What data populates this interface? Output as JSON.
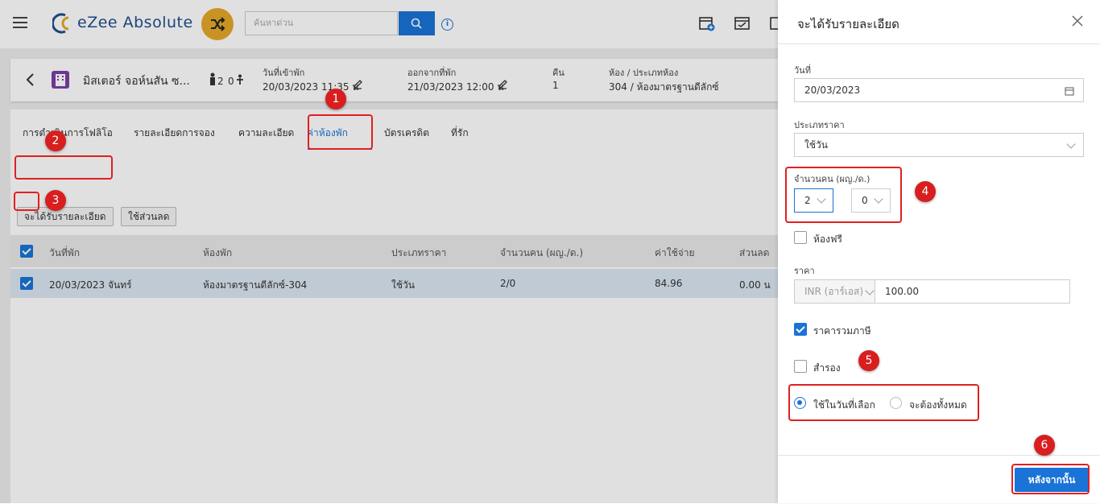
{
  "app": {
    "name": "eZee Absolute",
    "search_placeholder": "ค้นหาด่วน"
  },
  "guest": {
    "name": "มิสเตอร์ จอห์นสัน ซ...",
    "adults": "2",
    "children": "0",
    "checkin_label": "วันที่เข้าพัก",
    "checkin_value": "20/03/2023 11:35 น",
    "checkout_label": "ออกจากที่พัก",
    "checkout_value": "21/03/2023 12:00 น",
    "nights_label": "คืน",
    "nights_value": "1",
    "room_label": "ห้อง / ประเภทห้อง",
    "room_value": "304 / ห้องมาตรฐานดีลักซ์"
  },
  "tabs": [
    {
      "label": "การดำเนินการโฟลิโอ"
    },
    {
      "label": "รายละเอียดการจอง"
    },
    {
      "label": "ความละเอียด"
    },
    {
      "label": "ค่าห้องพัก",
      "active": true
    },
    {
      "label": "บัตรเครดิต"
    },
    {
      "label": "ที่รัก"
    }
  ],
  "actions": {
    "detail_button": "จะได้รับรายละเอียด",
    "discount_button": "ใช้ส่วนลด"
  },
  "table": {
    "headers": [
      "วันที่พัก",
      "ห้องพัก",
      "ประเภทราคา",
      "จำนวนคน (ผญ./ด.)",
      "ค่าใช้จ่าย",
      "ส่วนลด"
    ],
    "rows": [
      {
        "date": "20/03/2023 จันทร์",
        "room": "ห้องมาตรฐานดีลักซ์-304",
        "rate_type": "ใช้วัน",
        "pax": "2/0",
        "charge": "84.96",
        "discount": "0.00 น"
      }
    ]
  },
  "panel": {
    "title": "จะได้รับรายละเอียด",
    "date_label": "วันที่",
    "date_value": "20/03/2023",
    "rate_type_label": "ประเภทราคา",
    "rate_type_value": "ใช้วัน",
    "pax_label": "จำนวนคน (ผญ./ด.)",
    "adults_value": "2",
    "children_value": "0",
    "free_room_label": "ห้องฟรี",
    "free_room_checked": false,
    "price_label": "ราคา",
    "currency_value": "INR (อาร์เอส)",
    "price_value": "100.00",
    "tax_inclusive_label": "ราคารวมภาษี",
    "tax_inclusive_checked": true,
    "reserve_label": "สำรอง",
    "reserve_checked": false,
    "apply_options": [
      "ใช้ในวันที่เลือก",
      "จะต้องทั้งหมด"
    ],
    "apply_selected": "ใช้ในวันที่เลือก",
    "next_button": "หลังจากนั้น"
  },
  "annotations": [
    "1",
    "2",
    "3",
    "4",
    "5",
    "6"
  ],
  "colors": {
    "primary": "#1a73d6",
    "annotation": "#e02020",
    "brand": "#1f4e8c",
    "shuffle": "#e5a82a"
  }
}
